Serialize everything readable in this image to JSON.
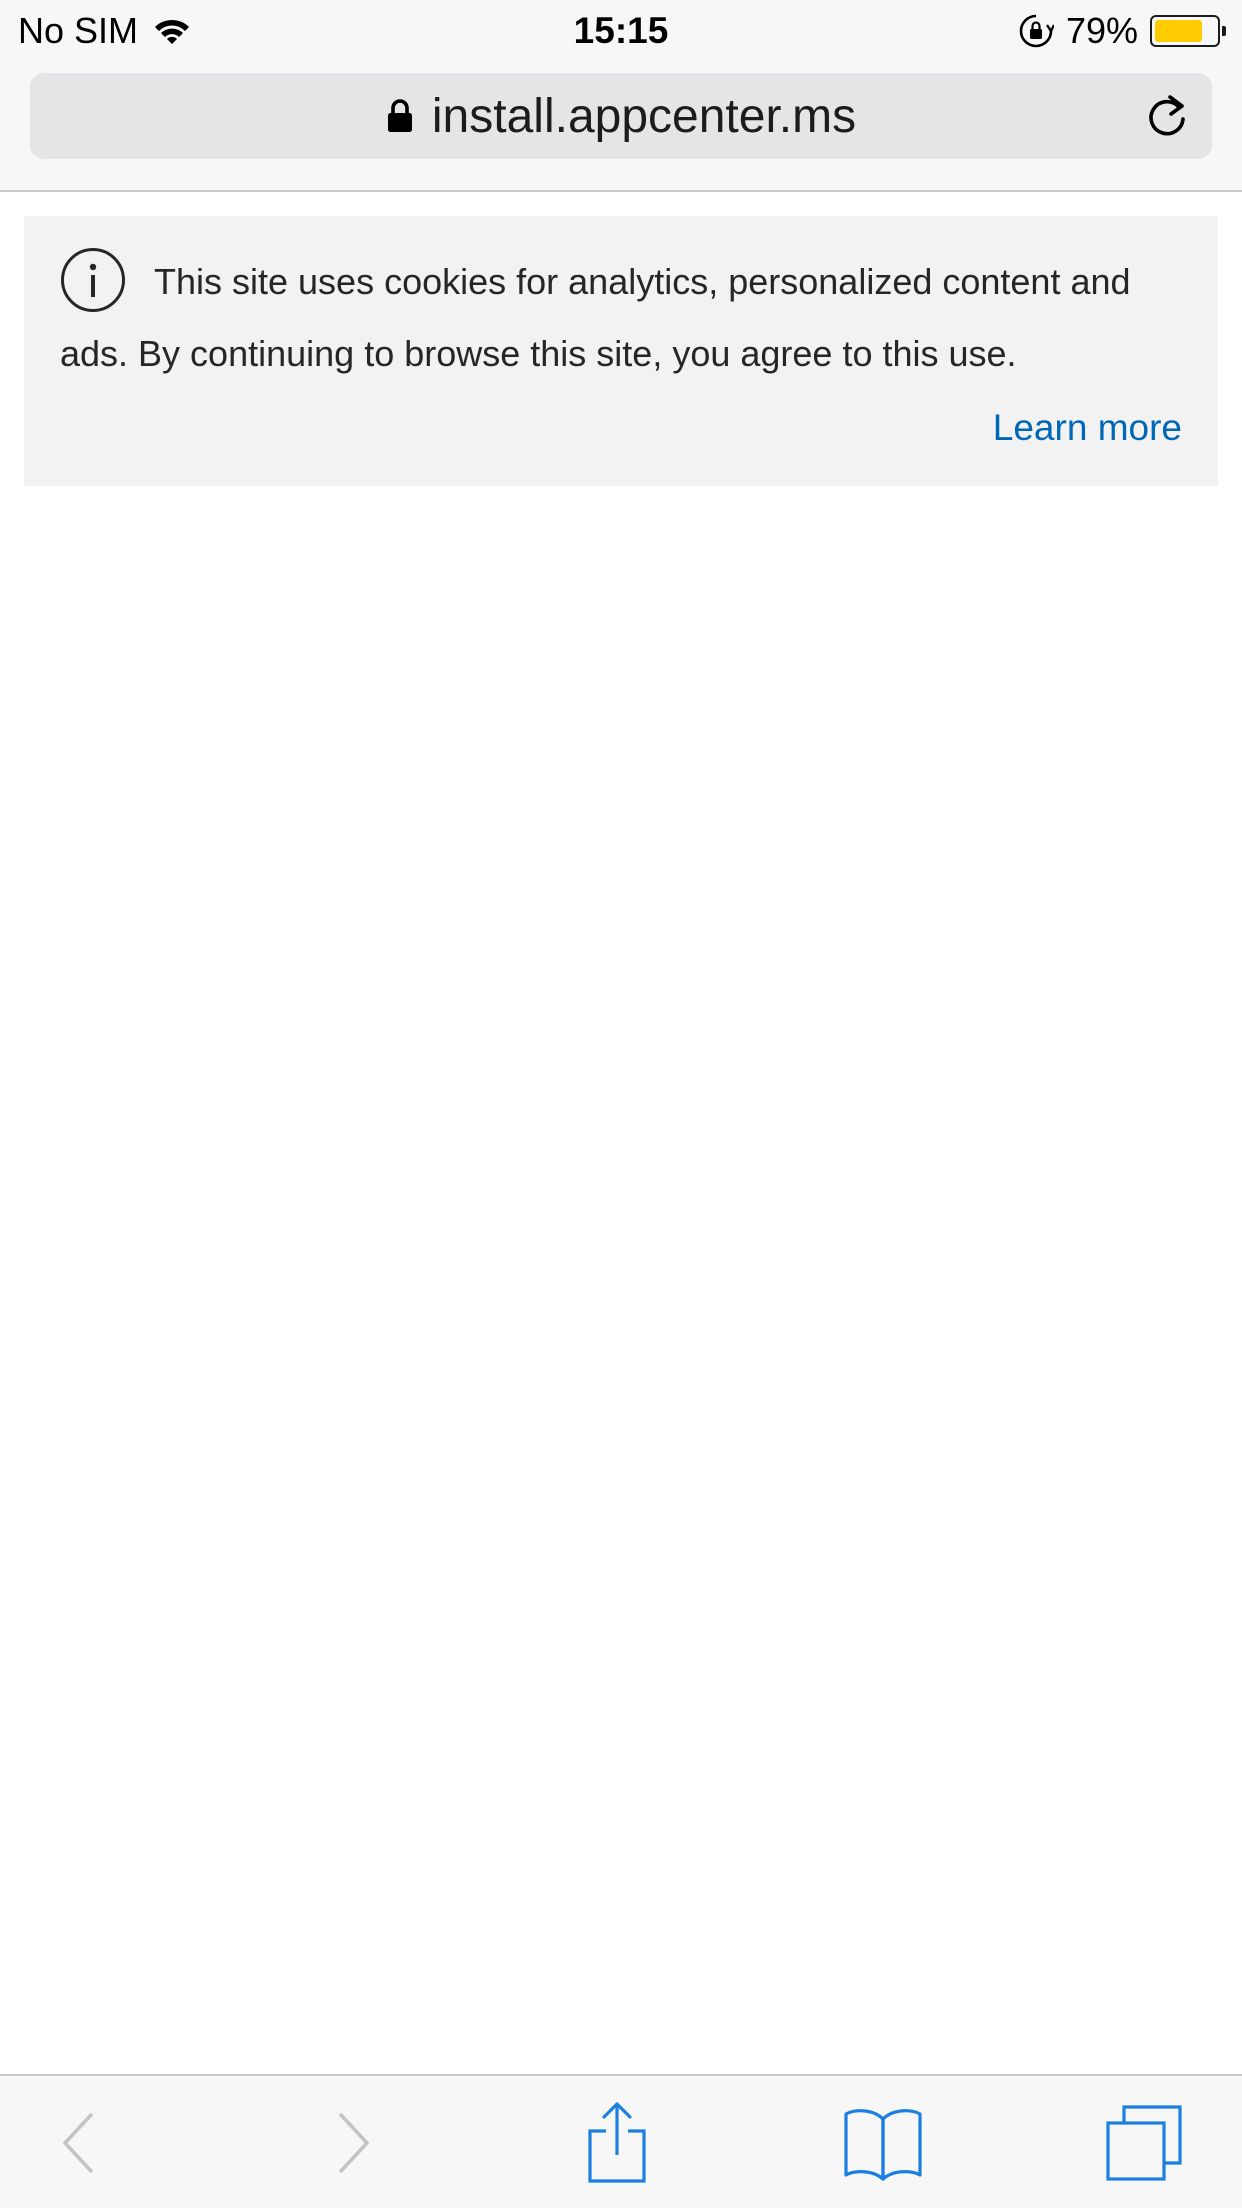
{
  "status_bar": {
    "carrier": "No SIM",
    "time": "15:15",
    "battery_percent_label": "79%",
    "battery_level": 0.79,
    "battery_color": "#ffcc00",
    "icons": [
      "wifi-icon",
      "rotation-lock-icon",
      "battery-icon"
    ]
  },
  "address_bar": {
    "url": "install.appcenter.ms",
    "secure": true,
    "icons": [
      "lock-icon",
      "reload-icon"
    ]
  },
  "cookie_banner": {
    "message": "This site uses cookies for analytics, personalized content and ads. By continuing to browse this site, you agree to this use.",
    "link_label": "Learn more",
    "link_color": "#0067b8",
    "icon": "info-icon"
  },
  "toolbar": {
    "accent_color": "#1a7fe0",
    "disabled_color": "#c4c4c6",
    "buttons": [
      {
        "name": "back",
        "icon": "chevron-left-icon",
        "enabled": false
      },
      {
        "name": "forward",
        "icon": "chevron-right-icon",
        "enabled": false
      },
      {
        "name": "share",
        "icon": "share-icon",
        "enabled": true
      },
      {
        "name": "bookmarks",
        "icon": "book-icon",
        "enabled": true
      },
      {
        "name": "tabs",
        "icon": "tabs-icon",
        "enabled": true
      }
    ]
  }
}
